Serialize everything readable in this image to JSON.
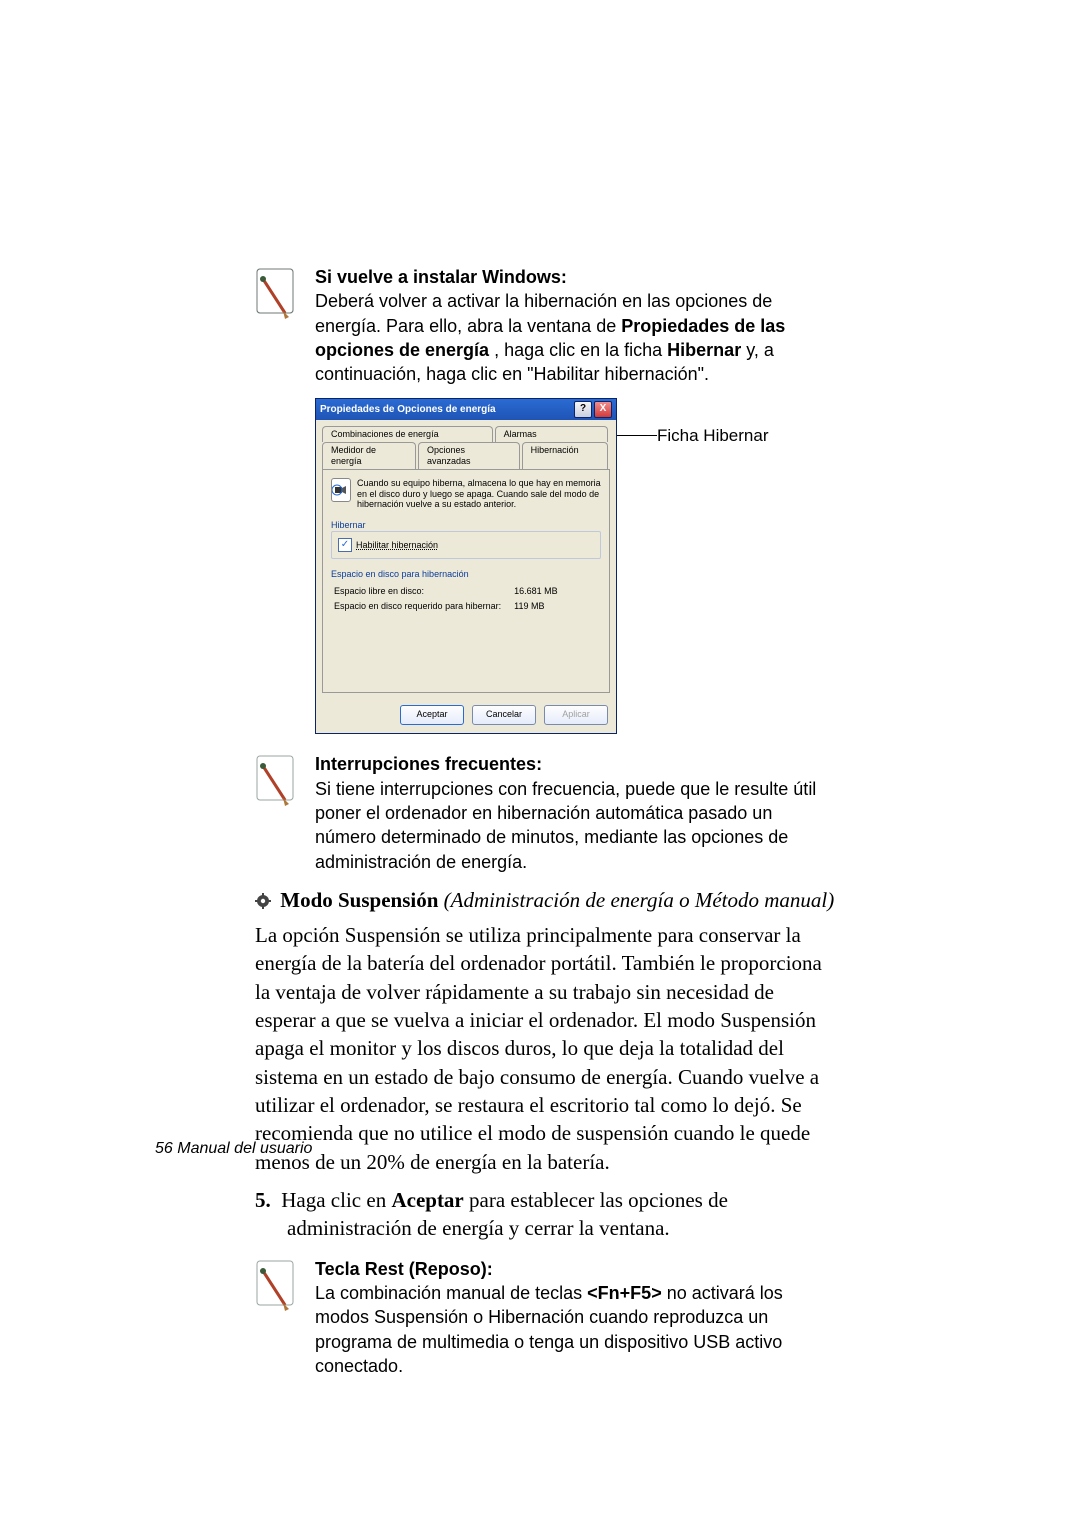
{
  "note1": {
    "title": "Si vuelve a instalar Windows:",
    "line1a": "Deberá volver a activar la hibernación en las opciones de energía. Para ello, abra la ventana de ",
    "bold1": "Propiedades de las opciones de energía",
    "line1b": " , haga clic en la ficha ",
    "bold2": "Hibernar",
    "line1c": " y, a continuación, haga clic en \"Habilitar hibernación\"."
  },
  "dialog": {
    "title": "Propiedades de Opciones de energía",
    "help": "?",
    "close": "X",
    "tabs_row1": [
      "Combinaciones de energía",
      "Alarmas"
    ],
    "tabs_row2": [
      "Medidor de energía",
      "Opciones avanzadas",
      "Hibernación"
    ],
    "desc": "Cuando su equipo hiberna, almacena lo que hay en memoria en el disco duro y luego se apaga. Cuando sale del modo de hibernación vuelve a su estado anterior.",
    "group_hibernar": "Hibernar",
    "checkbox_label": "Habilitar hibernación",
    "checked": "✓",
    "group_disk": "Espacio en disco para hibernación",
    "disk_free_label": "Espacio libre en disco:",
    "disk_free_value": "16.681 MB",
    "disk_req_label": "Espacio en disco requerido para hibernar:",
    "disk_req_value": "119 MB",
    "btn_ok": "Aceptar",
    "btn_cancel": "Cancelar",
    "btn_apply": "Aplicar"
  },
  "callout": "Ficha Hibernar",
  "note2": {
    "title": "Interrupciones frecuentes:",
    "body": "Si tiene interrupciones con frecuencia, puede que le resulte útil poner el ordenador en hibernación automática pasado un número determinado de minutos, mediante las opciones de administración de energía."
  },
  "heading": {
    "bold": "Modo Suspensión",
    "italic": " (Administración de energía o Método manual)"
  },
  "standby_para": "La opción Suspensión se utiliza principalmente para conservar la energía de la batería del ordenador portátil. También le proporciona la ventaja de volver rápidamente a su trabajo sin necesidad de esperar a que se vuelva a iniciar el ordenador. El modo Suspensión apaga el monitor y los discos duros, lo que deja la totalidad del sistema en un estado de bajo consumo de energía. Cuando vuelve a utilizar el ordenador, se restaura el escritorio tal como lo dejó. Se recomienda que no utilice el modo de suspensión cuando le quede menos de un 20% de energía en la batería.",
  "step5": {
    "num": "5.",
    "a": "Haga clic en ",
    "bold": "Aceptar",
    "b": " para establecer las opciones de administración de energía y cerrar la ventana."
  },
  "note3": {
    "title": "Tecla Rest (Reposo):",
    "a": "La combinación manual de teclas ",
    "bold": "<Fn+F5>",
    "b": " no activará los modos Suspensión o Hibernación cuando reproduzca un programa de multimedia o tenga un dispositivo USB activo conectado."
  },
  "footer": "56  Manual del usuario"
}
